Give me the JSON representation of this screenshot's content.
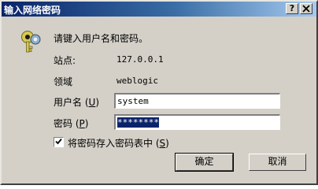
{
  "window": {
    "title": "输入网络密码"
  },
  "titlebar": {
    "help_label": "?",
    "close_label": "X"
  },
  "prompt": "请键入用户名和密码。",
  "site": {
    "label": "站点:",
    "value": "127.0.0.1"
  },
  "realm": {
    "label": "领域",
    "value": "weblogic"
  },
  "username": {
    "label": "用户名",
    "accel": "U",
    "value": "system"
  },
  "password": {
    "label": "密码",
    "accel": "P",
    "value": "********"
  },
  "save_password": {
    "checked": true,
    "label": "将密码存入密码表中",
    "accel": "S"
  },
  "buttons": {
    "ok": "确定",
    "cancel": "取消"
  },
  "icons": {
    "dialog": "key-icon",
    "check": "checkmark-icon"
  }
}
